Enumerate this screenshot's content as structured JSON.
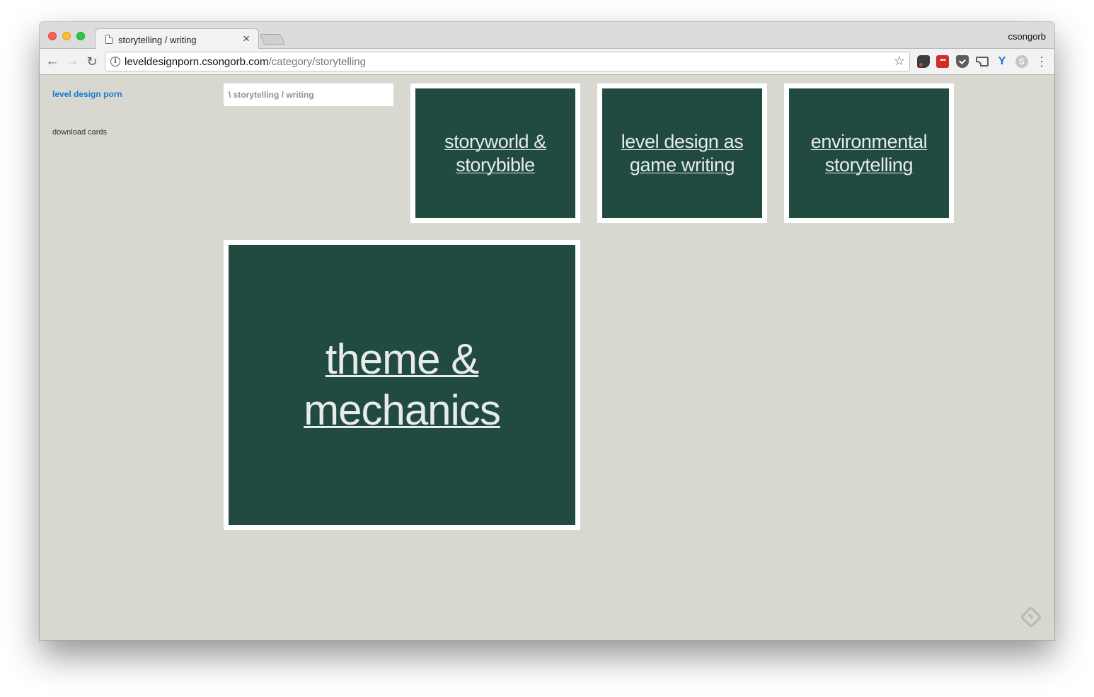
{
  "browser": {
    "tab_title": "storytelling / writing",
    "tab_close": "×",
    "profile_name": "csongorb",
    "url_host": "leveldesignporn.csongorb.com",
    "url_path": "/category/storytelling",
    "icons": {
      "back": "←",
      "forward": "→",
      "reload": "↻",
      "info": "i",
      "star": "☆",
      "menu": "⋮",
      "lastpass": "•••",
      "yoast": "Y",
      "skype": "S"
    }
  },
  "sidebar": {
    "site_title": "level design porn",
    "download_link": "download cards"
  },
  "main": {
    "breadcrumb": "\\ storytelling / writing",
    "cards": [
      {
        "title": "storyworld & storybible"
      },
      {
        "title": "level design as game writing"
      },
      {
        "title": "environmental storytelling"
      },
      {
        "title": "theme & mechanics"
      }
    ]
  },
  "colors": {
    "page_background": "#d9d8d0",
    "card_background": "#214a41",
    "card_border": "#ffffff",
    "link_blue": "#1b7ad3"
  }
}
